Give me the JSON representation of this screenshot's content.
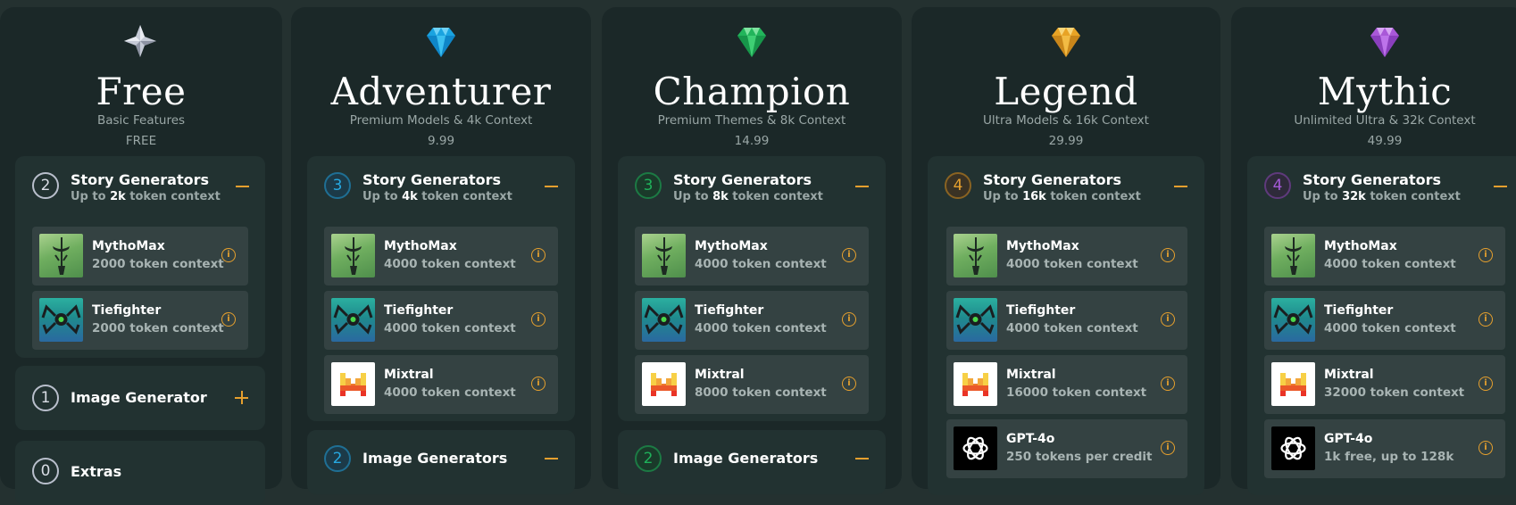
{
  "colors": {
    "free": "#b9bfcc",
    "adventurer": "#27a9e1",
    "champion": "#1fb15a",
    "legend": "#e6a02e",
    "mythic": "#a55ad8",
    "accent": "#e6a02e"
  },
  "plans": [
    {
      "gem_icon": "sparkle-star-icon",
      "title": "Free",
      "subtitle": "Basic Features",
      "price": "FREE",
      "story": {
        "count": "2",
        "title": "Story Generators",
        "sub_prefix": "Up to ",
        "sub_value": "2k",
        "sub_suffix": " token context",
        "toggle": "collapse",
        "models": [
          {
            "name": "MythoMax",
            "ctx": "2000 token context",
            "icon": "sword-icon"
          },
          {
            "name": "Tiefighter",
            "ctx": "2000 token context",
            "icon": "spider-icon"
          }
        ]
      },
      "image": {
        "count": "1",
        "title": "Image Generator",
        "toggle": "expand"
      },
      "extras": {
        "count": "0",
        "title": "Extras"
      }
    },
    {
      "gem_icon": "blue-diamond-icon",
      "title": "Adventurer",
      "subtitle": "Premium Models & 4k Context",
      "price": "9.99",
      "story": {
        "count": "3",
        "title": "Story Generators",
        "sub_prefix": "Up to ",
        "sub_value": "4k",
        "sub_suffix": " token context",
        "toggle": "collapse",
        "models": [
          {
            "name": "MythoMax",
            "ctx": "4000 token context",
            "icon": "sword-icon"
          },
          {
            "name": "Tiefighter",
            "ctx": "4000 token context",
            "icon": "spider-icon"
          },
          {
            "name": "Mixtral",
            "ctx": "4000 token context",
            "icon": "mistral-icon"
          }
        ]
      },
      "image": {
        "count": "2",
        "title": "Image Generators",
        "toggle": "collapse"
      }
    },
    {
      "gem_icon": "green-diamond-icon",
      "title": "Champion",
      "subtitle": "Premium Themes & 8k Context",
      "price": "14.99",
      "story": {
        "count": "3",
        "title": "Story Generators",
        "sub_prefix": "Up to ",
        "sub_value": "8k",
        "sub_suffix": " token context",
        "toggle": "collapse",
        "models": [
          {
            "name": "MythoMax",
            "ctx": "4000 token context",
            "icon": "sword-icon"
          },
          {
            "name": "Tiefighter",
            "ctx": "4000 token context",
            "icon": "spider-icon"
          },
          {
            "name": "Mixtral",
            "ctx": "8000 token context",
            "icon": "mistral-icon"
          }
        ]
      },
      "image": {
        "count": "2",
        "title": "Image Generators",
        "toggle": "collapse"
      }
    },
    {
      "gem_icon": "gold-diamond-icon",
      "title": "Legend",
      "subtitle": "Ultra Models & 16k Context",
      "price": "29.99",
      "story": {
        "count": "4",
        "title": "Story Generators",
        "sub_prefix": "Up to ",
        "sub_value": "16k",
        "sub_suffix": " token context",
        "toggle": "collapse",
        "models": [
          {
            "name": "MythoMax",
            "ctx": "4000 token context",
            "icon": "sword-icon"
          },
          {
            "name": "Tiefighter",
            "ctx": "4000 token context",
            "icon": "spider-icon"
          },
          {
            "name": "Mixtral",
            "ctx": "16000 token context",
            "icon": "mistral-icon"
          },
          {
            "name": "GPT-4o",
            "ctx": "250 tokens per credit",
            "icon": "openai-icon"
          }
        ]
      }
    },
    {
      "gem_icon": "purple-diamond-icon",
      "title": "Mythic",
      "subtitle": "Unlimited Ultra & 32k Context",
      "price": "49.99",
      "story": {
        "count": "4",
        "title": "Story Generators",
        "sub_prefix": "Up to ",
        "sub_value": "32k",
        "sub_suffix": " token context",
        "toggle": "collapse",
        "models": [
          {
            "name": "MythoMax",
            "ctx": "4000 token context",
            "icon": "sword-icon"
          },
          {
            "name": "Tiefighter",
            "ctx": "4000 token context",
            "icon": "spider-icon"
          },
          {
            "name": "Mixtral",
            "ctx": "32000 token context",
            "icon": "mistral-icon"
          },
          {
            "name": "GPT-4o",
            "ctx": "1k free, up to 128k",
            "icon": "openai-icon"
          }
        ]
      }
    }
  ]
}
